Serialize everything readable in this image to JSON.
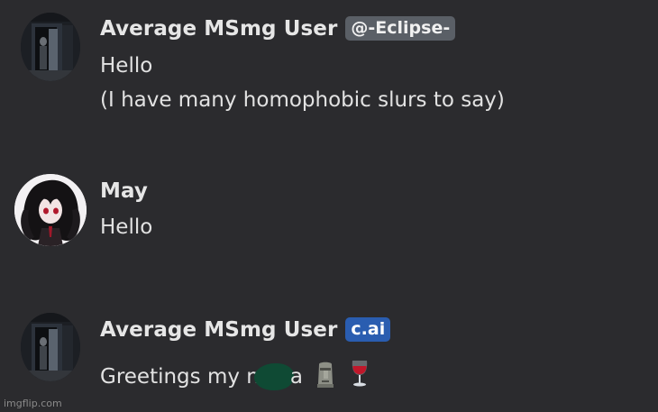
{
  "messages": [
    {
      "author": "Average MSmg User",
      "badge": "@-Eclipse-",
      "avatar": "dark-doorway-avatar",
      "lines": [
        "Hello",
        "(I have many homophobic slurs to say)"
      ]
    },
    {
      "author": "May",
      "avatar": "anime-girl-avatar",
      "lines": [
        "Hello"
      ]
    },
    {
      "author": "Average MSmg User",
      "badge": "c.ai",
      "avatar": "dark-doorway-avatar",
      "line_before_censor": "Greetings my n",
      "line_after_censor": "a",
      "emojis": [
        "moai-emoji",
        "wine-glass-emoji"
      ]
    }
  ],
  "watermark": "imgflip.com",
  "colors": {
    "background": "#2b2b2e",
    "badge_grey": "#5a5f66",
    "badge_blue": "#2a5db0",
    "censor_blob": "#0f4a34"
  }
}
